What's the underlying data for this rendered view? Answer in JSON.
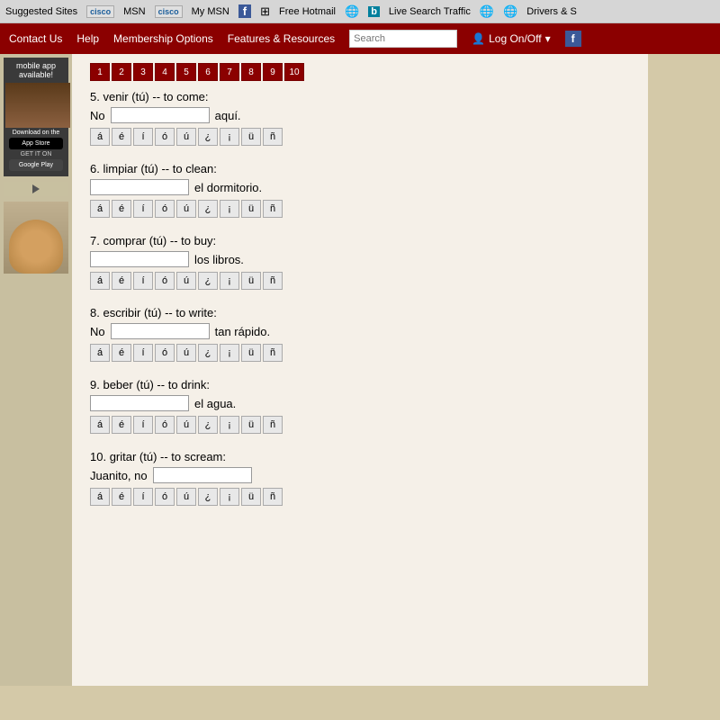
{
  "bookmarks": {
    "sites_label": "Suggested Sites",
    "cisco1": "MSN",
    "cisco2": "My MSN",
    "facebook": "f",
    "hotmail": "Free Hotmail",
    "live_search": "Live Search Traffic",
    "drivers": "Drivers & S"
  },
  "navbar": {
    "contact": "Contact Us",
    "help": "Help",
    "membership": "Membership Options",
    "features": "Features & Resources",
    "search_placeholder": "Search",
    "login": "Log On/Off"
  },
  "exercises": [
    {
      "number": "5",
      "verb": "venir (tú) -- to come:",
      "prefix": "No",
      "suffix": "aquí.",
      "chars": [
        "á",
        "é",
        "í",
        "ó",
        "ú",
        "¿",
        "¡",
        "ü",
        "ñ"
      ]
    },
    {
      "number": "6",
      "verb": "limpiar (tú) -- to clean:",
      "prefix": "",
      "suffix": "el dormitorio.",
      "chars": [
        "á",
        "é",
        "í",
        "ó",
        "ú",
        "¿",
        "¡",
        "ü",
        "ñ"
      ]
    },
    {
      "number": "7",
      "verb": "comprar (tú) -- to buy:",
      "prefix": "",
      "suffix": "los libros.",
      "chars": [
        "á",
        "é",
        "í",
        "ó",
        "ú",
        "¿",
        "¡",
        "ü",
        "ñ"
      ]
    },
    {
      "number": "8",
      "verb": "escribir (tú) -- to write:",
      "prefix": "No",
      "suffix": "tan rápido.",
      "chars": [
        "á",
        "é",
        "í",
        "ó",
        "ú",
        "¿",
        "¡",
        "ü",
        "ñ"
      ]
    },
    {
      "number": "9",
      "verb": "beber (tú) -- to drink:",
      "prefix": "",
      "suffix": "el agua.",
      "chars": [
        "á",
        "é",
        "í",
        "ó",
        "ú",
        "¿",
        "¡",
        "ü",
        "ñ"
      ]
    },
    {
      "number": "10",
      "verb": "gritar (tú) -- to scream:",
      "prefix": "Juanito, no",
      "suffix": "",
      "chars": [
        "á",
        "é",
        "í",
        "ó",
        "ú",
        "¿",
        "¡",
        "ü",
        "ñ"
      ]
    }
  ],
  "pagination": [
    "1",
    "2",
    "3",
    "4",
    "5",
    "6",
    "7",
    "8",
    "9",
    "10"
  ],
  "sidebar": {
    "app_text": "mobile app available!",
    "download_text": "Download on the",
    "app_store": "App Store",
    "get_on": "GET IT ON",
    "google_play": "Google Play"
  }
}
